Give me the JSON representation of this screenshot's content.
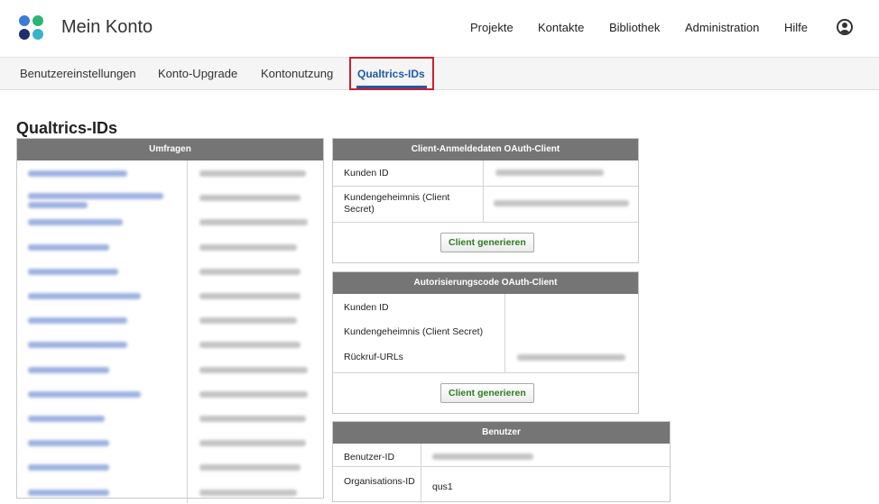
{
  "header": {
    "app_title": "Mein Konto",
    "logo_colors": [
      "#3a7bd5",
      "#2bb673",
      "#1d2f6f",
      "#36b4c9"
    ],
    "nav": [
      "Projekte",
      "Kontakte",
      "Bibliothek",
      "Administration",
      "Hilfe"
    ],
    "avatar_icon": "user-circle-icon"
  },
  "subnav": {
    "tabs": [
      "Benutzereinstellungen",
      "Konto-Upgrade",
      "Kontonutzung",
      "Qualtrics-IDs"
    ],
    "active_tab": "Qualtrics-IDs",
    "active_color": "#1e5aa8",
    "highlight_color": "#c8202d"
  },
  "page_title": "Qualtrics-IDs",
  "surveys_panel": {
    "title": "Umfragen",
    "row_count_visible": 14
  },
  "oauth_client_credentials": {
    "title": "Client-Anmeldedaten OAuth-Client",
    "fields": [
      "Kunden ID",
      "Kundengeheimnis (Client Secret)"
    ],
    "button": "Client generieren"
  },
  "oauth_authcode": {
    "title": "Autorisierungscode OAuth-Client",
    "fields": [
      "Kunden ID",
      "Kundengeheimnis (Client Secret)",
      "Rückruf-URLs"
    ],
    "button": "Client generieren"
  },
  "user_panel": {
    "title": "Benutzer",
    "fields": [
      "Benutzer-ID",
      "Organisations-ID"
    ],
    "org_id_value": "qus1"
  },
  "colors": {
    "panel_header": "#757575",
    "button_text": "#2f7a1e"
  }
}
